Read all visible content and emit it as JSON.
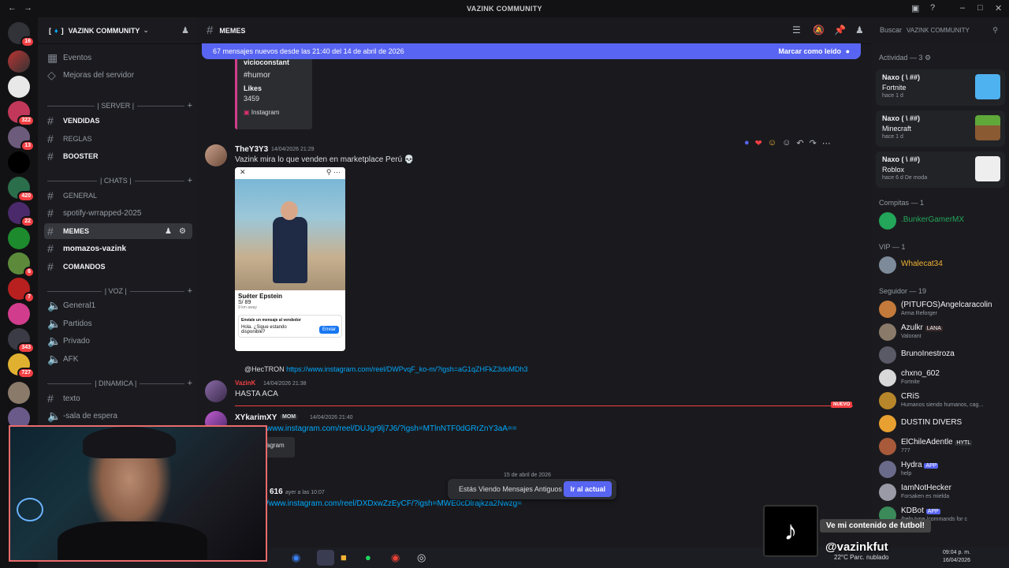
{
  "window": {
    "title": "VAZINK COMMUNITY"
  },
  "guild": {
    "name": "VAZINK COMMUNITY",
    "bracket_open": "[",
    "bracket_close": "]"
  },
  "sidebar": {
    "top_items": [
      {
        "label": "Eventos"
      },
      {
        "label": "Mejoras del servidor"
      }
    ],
    "categories": [
      {
        "label": "| SERVER |"
      },
      {
        "label": "| CHATS |"
      },
      {
        "label": "| VOZ |"
      },
      {
        "label": "| DINAMICA |"
      }
    ],
    "channels": [
      {
        "label": "VENDIDAS"
      },
      {
        "label": "REGLAS"
      },
      {
        "label": "BOOSTER"
      },
      {
        "label": "GENERAL"
      },
      {
        "label": "spotify-wrrapped-2025"
      },
      {
        "label": "MEMES"
      },
      {
        "label": "momazos-vazink"
      },
      {
        "label": "COMANDOS"
      },
      {
        "label": "General1"
      },
      {
        "label": "Partidos"
      },
      {
        "label": "Privado"
      },
      {
        "label": "AFK"
      },
      {
        "label": "texto"
      },
      {
        "label": "-sala de espera"
      }
    ]
  },
  "server_badges": [
    "16",
    "322",
    "13",
    "420",
    "22",
    "6",
    "7",
    "343",
    "727"
  ],
  "header": {
    "channel": "MEMES",
    "search_placeholder": "Buscar",
    "search_scope": "VAZINK COMMUNITY"
  },
  "newbar": {
    "text": "67 mensajes nuevos desde las 21:40 del 14 de abril de 2026",
    "action": "Marcar como leído"
  },
  "messages": {
    "embed": {
      "author": "vicioconstant",
      "tag": "#humor",
      "likes_label": "Likes",
      "likes": "3459",
      "source": "Instagram"
    },
    "m1": {
      "user": "TheY3Y3",
      "time": "14/04/2026 21:29",
      "text": "Vazink mira lo que venden en marketplace Perú 💀"
    },
    "card": {
      "title": "Suéter Epstein",
      "price": "S/ 89",
      "distance": "9 km away",
      "prompt": "Envíale un mensaje al vendedor",
      "draft": "Hola. ¿Sigue estando disponible?",
      "send": "Enviar"
    },
    "reply": {
      "user": "@HecTRON",
      "link": "https://www.instagram.com/reel/DWPvqF_ko-m/?igsh=aG1qZHFkZ3doMDh3"
    },
    "m2": {
      "user": "VazinK",
      "time": "14/04/2026 21:38",
      "text": "HASTA ACA"
    },
    "new_tag": "NUEVO",
    "m3": {
      "user": "XYkarimXY",
      "badge": "MOM",
      "time": "14/04/2026 21:40",
      "link": "www.instagram.com/reel/DUJgr9lj7J6/?igsh=MTlnNTF0dGRrZnY3aA==",
      "preview": "agram"
    },
    "date_sep": "15 de abril de 2026",
    "m4": {
      "user": "616",
      "time": "ayer a las 10:07",
      "link": "/www.instagram.com/reel/DXDxwZzEyCF/?igsh=MWE0cDlrajkza2Nwzg="
    }
  },
  "old_pill": {
    "text": "Estás Viendo Mensajes Antiguos",
    "action": "Ir al actual"
  },
  "members": {
    "activity_header": "Actividad — 3",
    "activities": [
      {
        "who": "Naxo ( \\ ##)",
        "game": "Fortnite",
        "when": "hace 1 d"
      },
      {
        "who": "Naxo ( \\ ##)",
        "game": "Minecraft",
        "when": "hace 1 d"
      },
      {
        "who": "Naxo ( \\ ##)",
        "game": "Roblox",
        "when": "hace 6 d",
        "extra": "De moda"
      }
    ],
    "groups": [
      {
        "label": "Compitas — 1"
      },
      {
        "label": "VIP — 1"
      },
      {
        "label": "Seguidor — 19"
      }
    ],
    "list": [
      {
        "name": ".BunkerGamerMX",
        "status": ""
      },
      {
        "name": "Whalecat34",
        "status": ""
      },
      {
        "name": "(PITUFOS)Angelcaracolin",
        "status": "Arma Reforger"
      },
      {
        "name": "Azulkr",
        "status": "Valorant",
        "tag": "LANA"
      },
      {
        "name": "BrunoInestroza",
        "status": ""
      },
      {
        "name": "chxno_602",
        "status": "Fortnite"
      },
      {
        "name": "CRiS",
        "status": "Humanos siendo humanos, cag..."
      },
      {
        "name": "DUSTIN DIVERS",
        "status": ""
      },
      {
        "name": "ElChileAdentle",
        "status": "777",
        "tag": "HYTL"
      },
      {
        "name": "Hydra",
        "status": "help",
        "tag": "APP"
      },
      {
        "name": "IamNotHecker",
        "status": "Forsaken es mielda"
      },
      {
        "name": "KDBot",
        "status": "/help type /commands for c",
        "tag": "APP"
      }
    ]
  },
  "overlay": {
    "caption": "Ve mi contenido de futbol!",
    "handle": "@vazinkfut"
  },
  "taskbar": {
    "weather": "22°C Parc. nublado",
    "time": "09:04 p. m.",
    "date": "16/04/2026"
  },
  "colors": {
    "accent": "#5865f2",
    "danger": "#f23f43",
    "vip": "#f0b232",
    "bunker": "#23a55a"
  }
}
